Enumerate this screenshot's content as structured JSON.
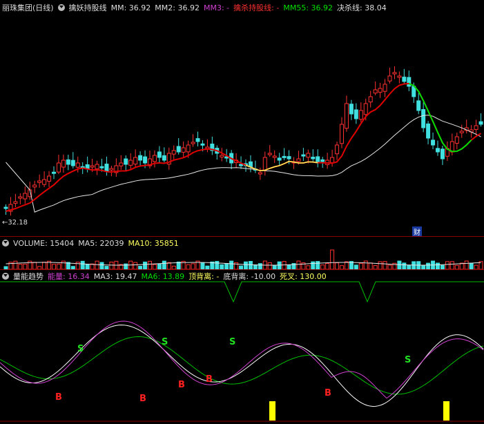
{
  "main_header": {
    "title": "丽珠集团(日线)",
    "indicator": "擒妖持股线",
    "mm_label": "MM:",
    "mm_value": "36.92",
    "mm2_label": "MM2:",
    "mm2_value": "36.92",
    "mm3_label": "MM3:",
    "mm3_value": "-",
    "qs_label": "擒杀持股线:",
    "qs_value": "-",
    "mm55_label": "MM55:",
    "mm55_value": "36.92",
    "jsx_label": "决杀线:",
    "jsx_value": "38.04"
  },
  "price_annotation": "←32.18",
  "event_badge": "财",
  "volume_header": {
    "title": "VOLUME:",
    "volume_value": "15404",
    "ma5_label": "MA5:",
    "ma5_value": "22039",
    "ma10_label": "MA10:",
    "ma10_value": "35851"
  },
  "energy_header": {
    "title": "量能趋势",
    "nl_label": "能量:",
    "nl_value": "16.34",
    "ma3_label": "MA3:",
    "ma3_value": "19.47",
    "ma6_label": "MA6:",
    "ma6_value": "13.89",
    "dbl_top_label": "顶背离:",
    "dbl_top_value": "-",
    "dbl_bot_label": "底背离:",
    "dbl_bot_value": "-10.00",
    "dead_label": "死叉:",
    "dead_value": "130.00"
  },
  "signals": {
    "buy": "B",
    "sell": "S"
  },
  "colors": {
    "up": "#ff3030",
    "down": "#40e0e0",
    "ma_red": "#e00000",
    "ma_green": "#00e000",
    "ma_white": "#e8e8e8",
    "magenta": "#d040d0",
    "yellow": "#ffff00",
    "grid": "#8b0000"
  }
}
